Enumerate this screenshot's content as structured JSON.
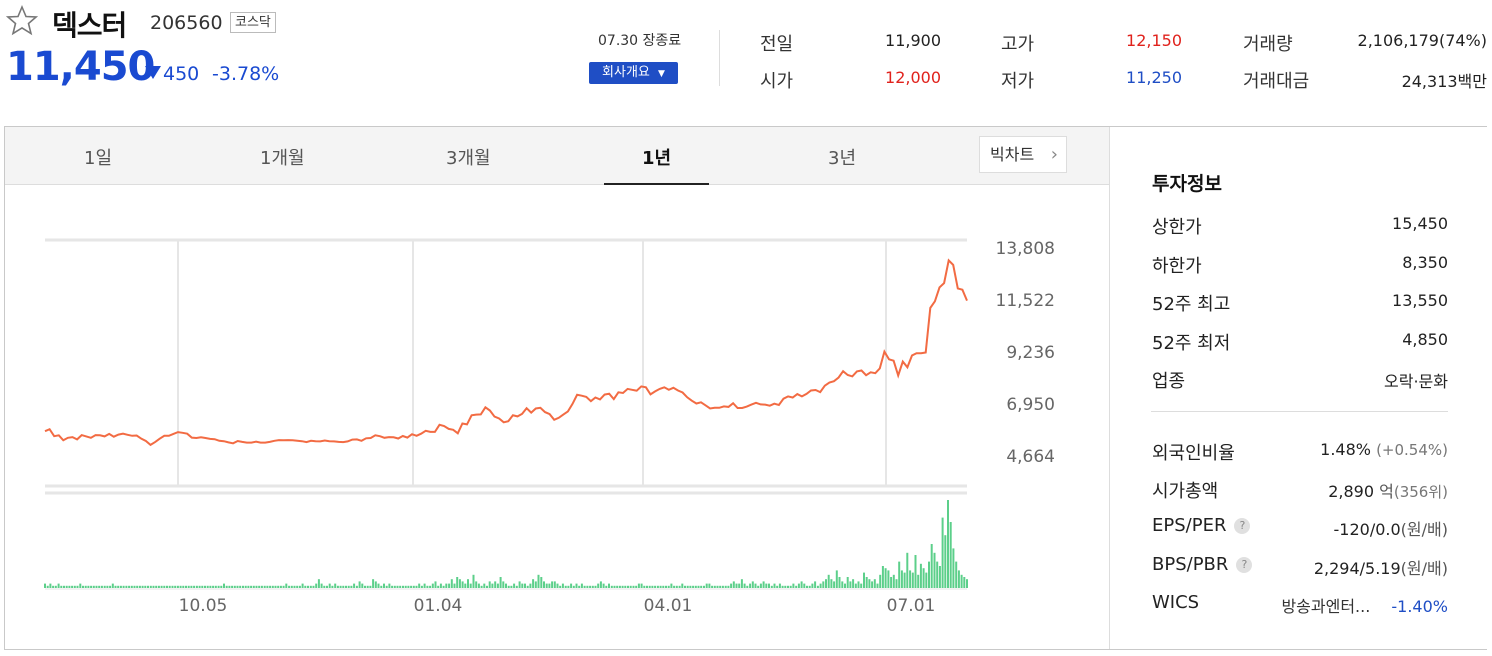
{
  "header": {
    "name": "덱스터",
    "code": "206560",
    "market": "코스닥",
    "price": "11,450",
    "change": "450",
    "change_pct": "-3.78%",
    "market_time": "07.30 장종료",
    "overview_button": "회사개요"
  },
  "quote": {
    "prev_label": "전일",
    "prev_value": "11,900",
    "open_label": "시가",
    "open_value": "12,000",
    "high_label": "고가",
    "high_value": "12,150",
    "low_label": "저가",
    "low_value": "11,250",
    "volume_label": "거래량",
    "volume_value": "2,106,179(74%)",
    "amount_label": "거래대금",
    "amount_value": "24,313백만"
  },
  "tabs": [
    "1일",
    "1개월",
    "3개월",
    "1년",
    "3년"
  ],
  "active_tab": "1년",
  "bigchart_label": "빅차트",
  "info": {
    "title": "투자정보",
    "upper_label": "상한가",
    "upper_value": "15,450",
    "lower_label": "하한가",
    "lower_value": "8,350",
    "high52_label": "52주 최고",
    "high52_value": "13,550",
    "low52_label": "52주 최저",
    "low52_value": "4,850",
    "industry_label": "업종",
    "industry_value": "오락·문화",
    "foreign_label": "외국인비율",
    "foreign_value": "1.48%",
    "foreign_change": "(+0.54%)",
    "mktcap_label": "시가총액",
    "mktcap_value": "2,890",
    "mktcap_unit": "억",
    "mktcap_rank": "(356위)",
    "eps_label": "EPS/PER",
    "eps_value": "-120/0.0",
    "eps_unit": "(원/배)",
    "bps_label": "BPS/PBR",
    "bps_value": "2,294/5.19",
    "bps_unit": "(원/배)",
    "wics_label": "WICS",
    "wics_value": "방송과엔터...",
    "wics_change": "-1.40%"
  },
  "colors": {
    "up": "#e0221c",
    "down": "#1f4ec5",
    "line": "#f26b43",
    "volume": "#5ccf8a"
  },
  "chart_data": {
    "type": "line",
    "x_ticks": [
      "10.05",
      "01.04",
      "04.01",
      "07.01"
    ],
    "y_ticks": [
      "13,808",
      "11,522",
      "9,236",
      "6,950",
      "4,664"
    ],
    "ylim": [
      4664,
      13808
    ],
    "price_series": [
      5710,
      5800,
      5490,
      5530,
      5310,
      5420,
      5450,
      5350,
      5540,
      5480,
      5420,
      5540,
      5530,
      5480,
      5590,
      5470,
      5560,
      5600,
      5550,
      5510,
      5520,
      5380,
      5280,
      5110,
      5230,
      5380,
      5510,
      5510,
      5590,
      5670,
      5640,
      5600,
      5430,
      5410,
      5440,
      5410,
      5370,
      5360,
      5290,
      5270,
      5220,
      5180,
      5280,
      5240,
      5210,
      5210,
      5250,
      5210,
      5210,
      5240,
      5290,
      5320,
      5310,
      5320,
      5310,
      5290,
      5270,
      5230,
      5290,
      5270,
      5260,
      5300,
      5270,
      5260,
      5240,
      5230,
      5260,
      5340,
      5350,
      5290,
      5400,
      5410,
      5530,
      5490,
      5420,
      5450,
      5440,
      5390,
      5500,
      5430,
      5580,
      5510,
      5600,
      5730,
      5680,
      5680,
      5990,
      5940,
      5810,
      5770,
      5620,
      6050,
      6010,
      6410,
      6440,
      6450,
      6760,
      6620,
      6350,
      6270,
      6100,
      6150,
      6410,
      6360,
      6470,
      6720,
      6530,
      6710,
      6740,
      6550,
      6460,
      6210,
      6300,
      6440,
      6580,
      6910,
      7310,
      7270,
      7220,
      7030,
      7190,
      7110,
      7320,
      7360,
      7120,
      7420,
      7390,
      7570,
      7530,
      7490,
      7680,
      7640,
      7330,
      7460,
      7570,
      7640,
      7530,
      7620,
      7500,
      7410,
      7200,
      7050,
      6930,
      6980,
      6850,
      6710,
      6740,
      6740,
      6800,
      6780,
      6940,
      6730,
      6730,
      6790,
      6880,
      6960,
      6890,
      6880,
      6830,
      6920,
      6860,
      7140,
      7240,
      7190,
      7340,
      7240,
      7350,
      7500,
      7520,
      7430,
      7710,
      7850,
      7910,
      8070,
      8350,
      8180,
      8120,
      8340,
      8380,
      8170,
      8300,
      8260,
      8470,
      9210,
      8870,
      8810,
      8160,
      8770,
      8520,
      9040,
      9140,
      9140,
      9170,
      11130,
      11420,
      12030,
      12220,
      13220,
      13020,
      11990,
      11930,
      11450
    ],
    "volume_series": [
      2,
      1,
      2,
      1,
      1,
      2,
      1,
      1,
      1,
      1,
      1,
      1,
      1,
      2,
      1,
      1,
      1,
      1,
      1,
      1,
      1,
      1,
      1,
      1,
      1,
      2,
      1,
      1,
      1,
      1,
      1,
      1,
      1,
      1,
      1,
      1,
      1,
      1,
      1,
      1,
      1,
      1,
      1,
      1,
      1,
      1,
      1,
      1,
      1,
      1,
      1,
      1,
      1,
      1,
      1,
      1,
      1,
      1,
      1,
      1,
      1,
      1,
      1,
      1,
      1,
      1,
      2,
      1,
      1,
      1,
      1,
      1,
      1,
      1,
      1,
      1,
      1,
      1,
      1,
      1,
      1,
      1,
      1,
      1,
      1,
      1,
      1,
      1,
      1,
      2,
      1,
      1,
      1,
      1,
      1,
      2,
      1,
      1,
      1,
      1,
      2,
      4,
      2,
      1,
      1,
      2,
      1,
      2,
      1,
      1,
      1,
      1,
      1,
      1,
      2,
      1,
      3,
      2,
      1,
      1,
      1,
      4,
      3,
      2,
      1,
      2,
      1,
      2,
      1,
      1,
      1,
      1,
      1,
      1,
      1,
      1,
      1,
      1,
      2,
      1,
      2,
      1,
      1,
      2,
      3,
      1,
      2,
      1,
      2,
      2,
      4,
      2,
      5,
      4,
      3,
      2,
      4,
      2,
      6,
      3,
      2,
      1,
      2,
      1,
      3,
      2,
      3,
      2,
      5,
      3,
      2,
      1,
      1,
      2,
      1,
      3,
      2,
      2,
      1,
      2,
      4,
      3,
      6,
      5,
      3,
      2,
      2,
      3,
      3,
      2,
      1,
      2,
      1,
      1,
      2,
      1,
      2,
      1,
      2,
      1,
      1,
      1,
      1,
      1,
      2,
      3,
      2,
      1,
      2,
      1,
      1,
      1,
      1,
      1,
      1,
      1,
      1,
      1,
      1,
      2,
      2,
      1,
      1,
      1,
      1,
      1,
      1,
      1,
      1,
      1,
      1,
      2,
      1,
      1,
      1,
      2,
      1,
      1,
      1,
      1,
      1,
      1,
      1,
      1,
      2,
      2,
      1,
      1,
      1,
      1,
      1,
      1,
      1,
      2,
      3,
      2,
      2,
      4,
      2,
      1,
      2,
      3,
      2,
      1,
      2,
      3,
      2,
      2,
      1,
      2,
      1,
      2,
      1,
      1,
      1,
      1,
      2,
      1,
      2,
      3,
      2,
      1,
      1,
      2,
      3,
      1,
      2,
      3,
      4,
      6,
      4,
      3,
      8,
      5,
      3,
      2,
      5,
      3,
      4,
      2,
      3,
      2,
      7,
      5,
      4,
      3,
      4,
      2,
      6,
      10,
      9,
      8,
      5,
      6,
      4,
      12,
      8,
      7,
      16,
      8,
      7,
      15,
      6,
      11,
      9,
      7,
      12,
      20,
      16,
      12,
      10,
      32,
      24,
      40,
      30,
      18,
      12,
      8,
      6,
      5,
      4
    ]
  }
}
